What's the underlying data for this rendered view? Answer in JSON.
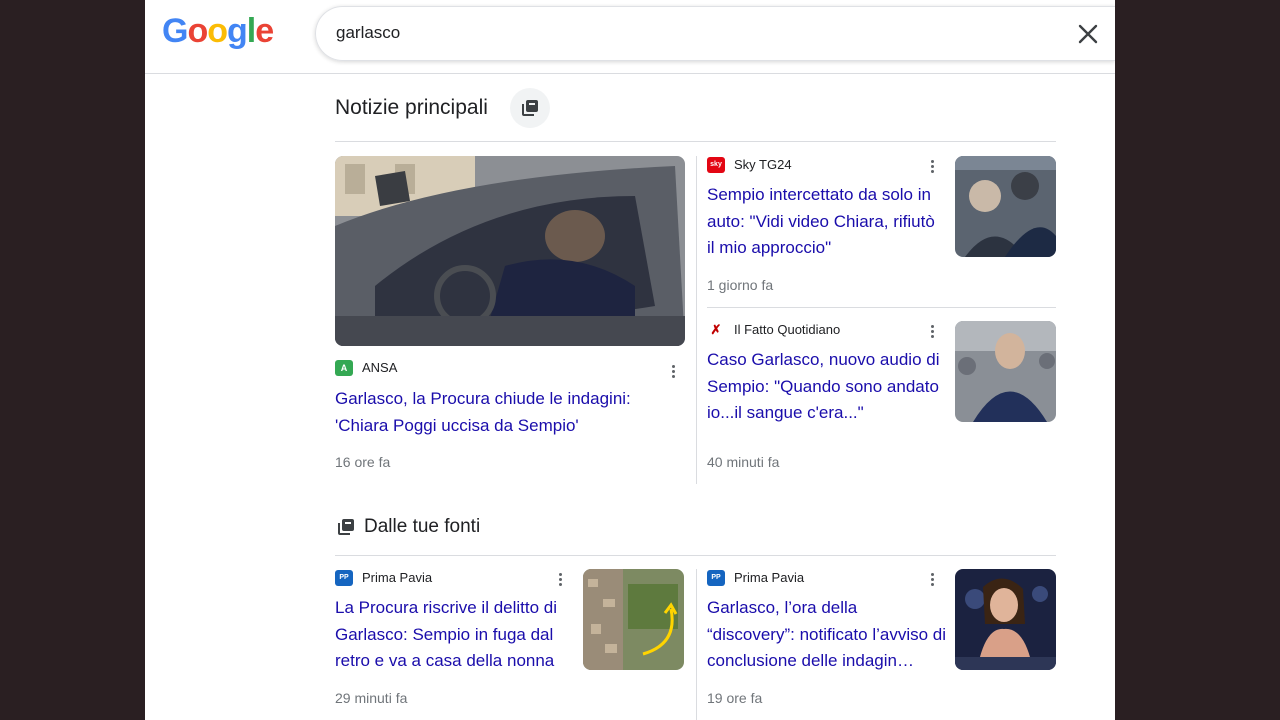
{
  "header": {
    "logo_letters": [
      {
        "char": "G",
        "color": "#4285F4"
      },
      {
        "char": "o",
        "color": "#EA4335"
      },
      {
        "char": "o",
        "color": "#FBBC05"
      },
      {
        "char": "g",
        "color": "#4285F4"
      },
      {
        "char": "l",
        "color": "#34A853"
      },
      {
        "char": "e",
        "color": "#EA4335"
      }
    ],
    "search_query": "garlasco",
    "clear_icon": "close-icon"
  },
  "top_stories": {
    "title": "Notizie principali",
    "icon": "stack-icon",
    "items": [
      {
        "source": "ANSA",
        "source_logo_text": "A",
        "source_color": "#34A853",
        "headline": "Garlasco, la Procura chiude le indagini: 'Chiara Poggi uccisa da Sempio'",
        "time": "16 ore fa"
      },
      {
        "source": "Sky TG24",
        "source_logo_text": "sky",
        "source_color": "#e30613",
        "headline": "Sempio intercettato da solo in auto: \"Vidi video Chiara, rifiutò il mio approccio\"",
        "time": "1 giorno fa"
      },
      {
        "source": "Il Fatto Quotidiano",
        "source_logo_text": "✗",
        "source_color": "#c00000",
        "headline": "Caso Garlasco, nuovo audio di Sempio: \"Quando sono andato io...il sangue c'era...\"",
        "time": "40 minuti fa"
      }
    ]
  },
  "your_sources": {
    "title": "Dalle tue fonti",
    "icon": "stack-icon",
    "items": [
      {
        "source": "Prima Pavia",
        "source_logo_text": "PP",
        "source_color": "#1565c0",
        "headline": "La Procura riscrive il delitto di Garlasco: Sempio in fuga dal retro e va a casa della nonna",
        "time": "29 minuti fa"
      },
      {
        "source": "Prima Pavia",
        "source_logo_text": "PP",
        "source_color": "#1565c0",
        "headline": "Garlasco, l’ora della “discovery”: notificato l’avviso di conclusione delle indagin…",
        "time": "19 ore fa"
      }
    ]
  }
}
